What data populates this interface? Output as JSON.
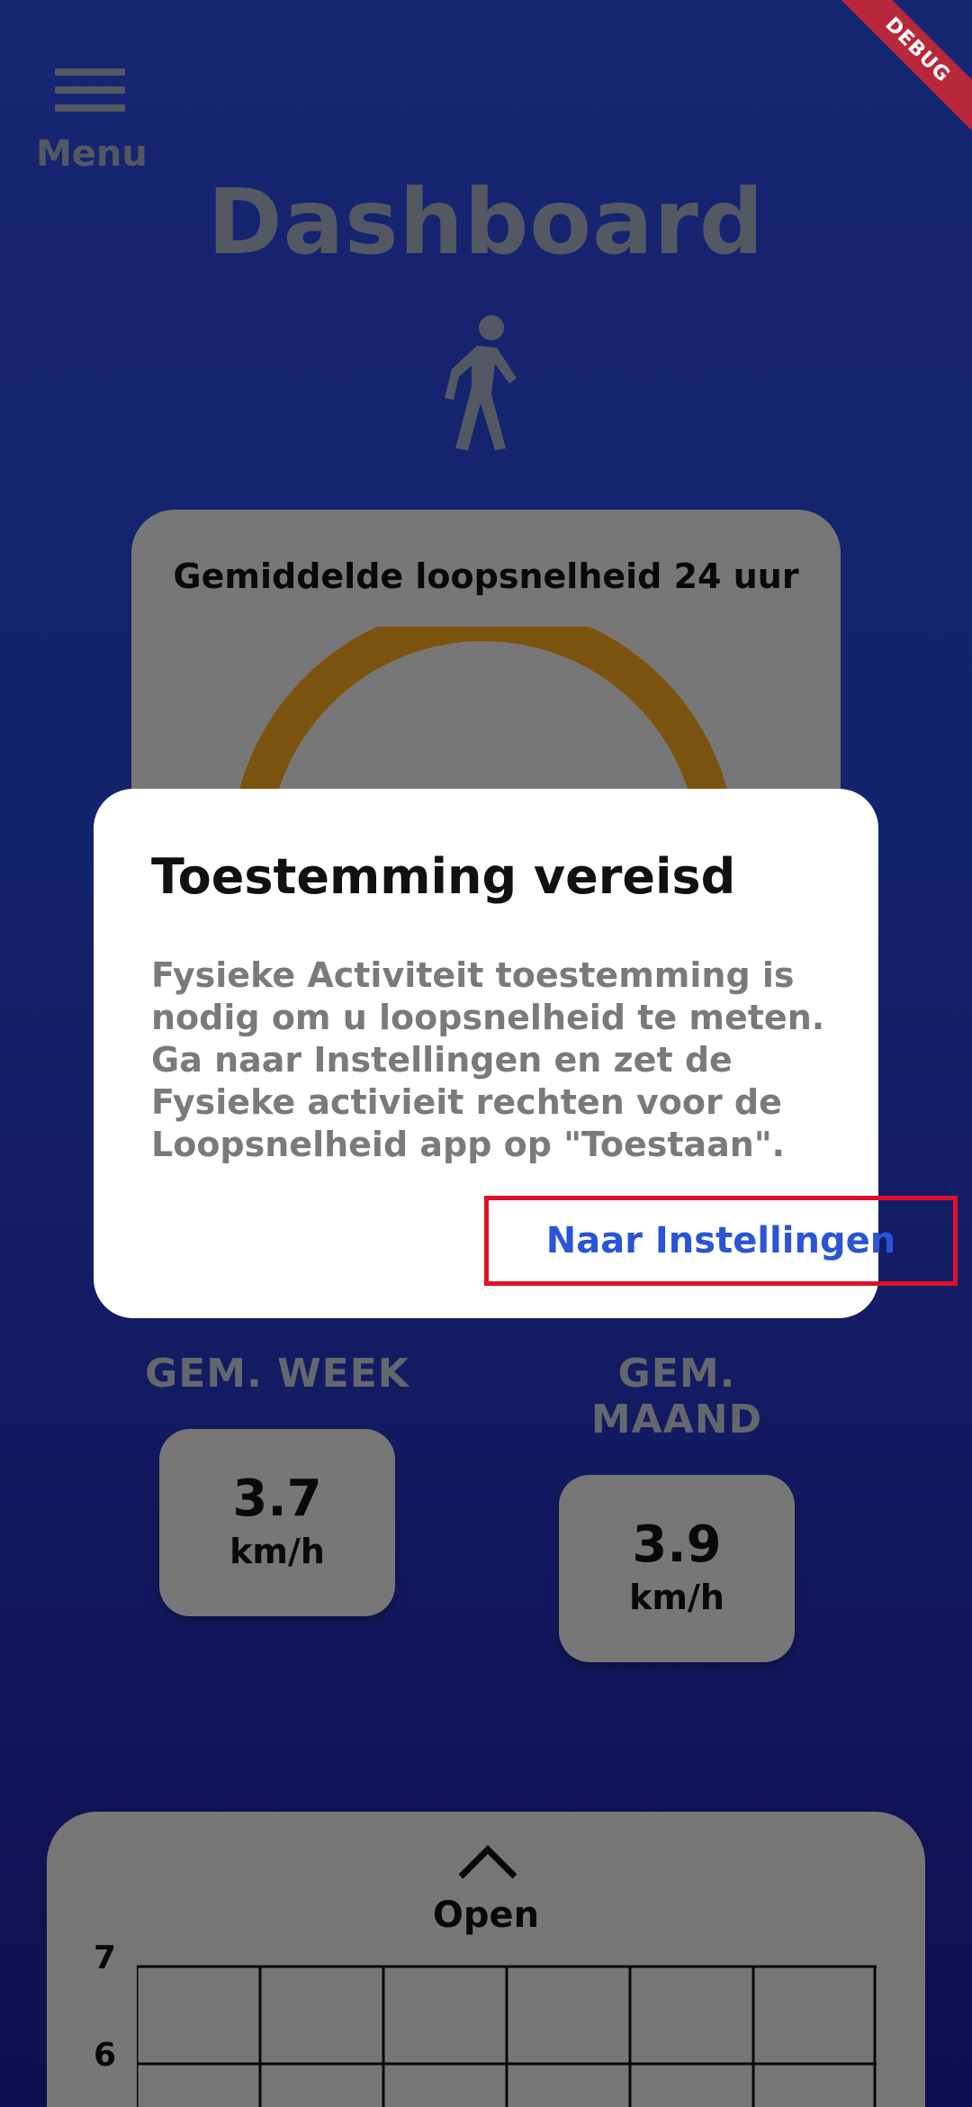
{
  "menu": {
    "label": "Menu"
  },
  "page": {
    "title": "Dashboard"
  },
  "speed_card": {
    "title": "Gemiddelde loopsnelheid 24 uur"
  },
  "stats": [
    {
      "label": "GEM. WEEK",
      "value": "3.7",
      "unit": "km/h"
    },
    {
      "label": "GEM. MAAND",
      "value": "3.9",
      "unit": "km/h"
    }
  ],
  "chart_panel": {
    "toggle_label": "Open",
    "y_ticks": [
      "7",
      "6"
    ]
  },
  "debug_banner": "DEBUG",
  "dialog": {
    "title": "Toestemming vereisd",
    "body": "Fysieke Activiteit toestemming is nodig om u loopsnelheid te meten. Ga naar Instellingen en zet de Fysieke activieit rechten voor de Loopsnelheid app op \"Toestaan\".",
    "action_label": "Naar Instellingen"
  },
  "colors": {
    "accent": "#2a55d6",
    "gauge": "#e29a1c",
    "highlight": "#e0102a"
  },
  "icons": {
    "menu": "hamburger-icon",
    "activity": "walking-person-icon",
    "expand": "chevron-up-icon"
  }
}
